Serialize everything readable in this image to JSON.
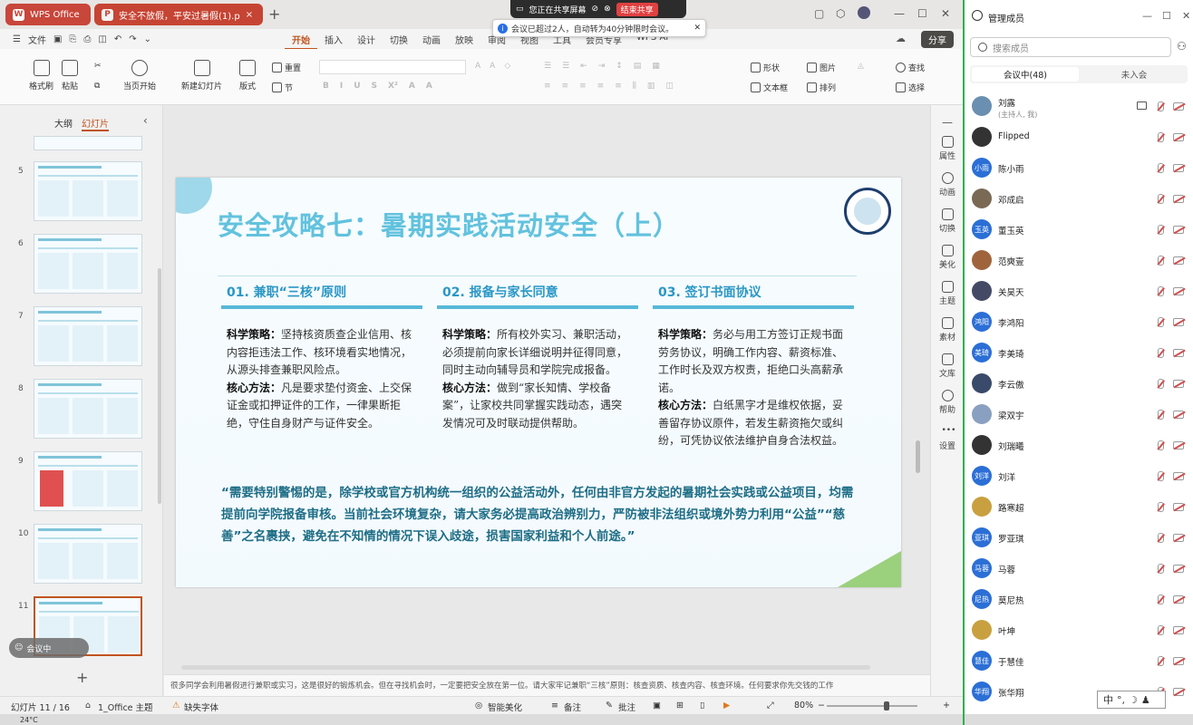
{
  "titlebar": {
    "tabs": [
      {
        "label": "WPS Office",
        "logo": "W"
      },
      {
        "label": "安全不放假，平安过暑假(1).p",
        "logo": "P"
      }
    ]
  },
  "share": {
    "status": "您正在共享屏幕",
    "stop": "结束共享",
    "notice": "会议已超过2人，自动转为40分钟限时会议。"
  },
  "menu": {
    "file": "文件",
    "tabs": [
      "开始",
      "插入",
      "设计",
      "切换",
      "动画",
      "放映",
      "审阅",
      "视图",
      "工具",
      "会员专享",
      "WPS AI"
    ],
    "share": "分享"
  },
  "ribbon": {
    "format_painter": "格式刷",
    "paste": "粘贴",
    "from_current": "当页开始",
    "new_slide": "新建幻灯片",
    "layout": "版式",
    "reset": "重置",
    "section": "节",
    "shape": "形状",
    "picture": "图片",
    "find": "查找",
    "textbox": "文本框",
    "arrange": "排列",
    "select": "选择"
  },
  "left_panel": {
    "tab_outline": "大纲",
    "tab_slides": "幻灯片",
    "slide_numbers": [
      "5",
      "6",
      "7",
      "8",
      "9",
      "10",
      "11"
    ],
    "meeting_pill": "会议中"
  },
  "slide": {
    "title": "安全攻略七：暑期实践活动安全（上）",
    "columns": [
      {
        "heading": "01. 兼职“三核”原则",
        "strategy_label": "科学策略：",
        "strategy": "坚持核资质查企业信用、核内容拒违法工作、核环境看实地情况，从源头排查兼职风险点。",
        "method_label": "核心方法：",
        "method": "凡是要求垫付资金、上交保证金或扣押证件的工作，一律果断拒绝，守住自身财产与证件安全。"
      },
      {
        "heading": "02. 报备与家长同意",
        "strategy_label": "科学策略：",
        "strategy": "所有校外实习、兼职活动，必须提前向家长详细说明并征得同意，同时主动向辅导员和学院完成报备。",
        "method_label": "核心方法：",
        "method": "做到“家长知情、学校备案”，让家校共同掌握实践动态，遇突发情况可及时联动提供帮助。"
      },
      {
        "heading": "03. 签订书面协议",
        "strategy_label": "科学策略：",
        "strategy": "务必与用工方签订正规书面劳务协议，明确工作内容、薪资标准、工作时长及双方权责，拒绝口头高薪承诺。",
        "method_label": "核心方法：",
        "method": "白纸黑字才是维权依据，妥善留存协议原件，若发生薪资拖欠或纠纷，可凭协议依法维护自身合法权益。"
      }
    ],
    "quote": "“需要特别警惕的是，除学校或官方机构统一组织的公益活动外，任何由非官方发起的暑期社会实践或公益项目，均需提前向学院报备审核。当前社会环境复杂，请大家务必提高政治辨别力，严防被非法组织或境外势力利用“公益”“慈善”之名裹挟，避免在不知情的情况下误入歧途，损害国家利益和个人前途。”"
  },
  "notes": "很多同学会利用暑假进行兼职或实习，这是很好的锻炼机会。但在寻找机会时，一定要把安全放在第一位。请大家牢记兼职“三核”原则：核查资质、核查内容、核查环境。任何要求你先交钱的工作",
  "right_tools": [
    "属性",
    "动画",
    "切换",
    "美化",
    "主题",
    "素材",
    "文库",
    "帮助",
    "设置"
  ],
  "status": {
    "slide_count": "幻灯片 11 / 16",
    "theme": "1_Office 主题",
    "missing_font": "缺失字体",
    "smart": "智能美化",
    "notes": "备注",
    "comments": "批注",
    "zoom": "80%"
  },
  "taskbar": {
    "weather": "24°C"
  },
  "members": {
    "title": "管理成员",
    "search_placeholder": "搜索成员",
    "tab_in": "会议中(48)",
    "tab_out": "未入会",
    "list": [
      {
        "name": "刘露",
        "sub": "(主持人, 我)",
        "avatar": "",
        "color": "#6a8fb0"
      },
      {
        "name": "Flipped",
        "sub": "",
        "avatar": "",
        "color": "#333333"
      },
      {
        "name": "陈小雨",
        "sub": "",
        "avatar": "小雨",
        "color": "#2b6fd6"
      },
      {
        "name": "邓成启",
        "sub": "",
        "avatar": "",
        "color": "#7a6a55"
      },
      {
        "name": "董玉英",
        "sub": "",
        "avatar": "玉英",
        "color": "#2b6fd6"
      },
      {
        "name": "范奭壹",
        "sub": "",
        "avatar": "",
        "color": "#a0643c"
      },
      {
        "name": "关昊天",
        "sub": "",
        "avatar": "",
        "color": "#444a66"
      },
      {
        "name": "李鸿阳",
        "sub": "",
        "avatar": "鸿阳",
        "color": "#2b6fd6"
      },
      {
        "name": "李美琦",
        "sub": "",
        "avatar": "美琦",
        "color": "#2b6fd6"
      },
      {
        "name": "李云傲",
        "sub": "",
        "avatar": "",
        "color": "#3a4a6a"
      },
      {
        "name": "梁双宇",
        "sub": "",
        "avatar": "",
        "color": "#8aa0c0"
      },
      {
        "name": "刘瑞曦",
        "sub": "",
        "avatar": "",
        "color": "#333333"
      },
      {
        "name": "刘洋",
        "sub": "",
        "avatar": "刘洋",
        "color": "#2b6fd6"
      },
      {
        "name": "路寒超",
        "sub": "",
        "avatar": "",
        "color": "#c8a040"
      },
      {
        "name": "罗亚琪",
        "sub": "",
        "avatar": "亚琪",
        "color": "#2b6fd6"
      },
      {
        "name": "马蓉",
        "sub": "",
        "avatar": "马蓉",
        "color": "#2b6fd6"
      },
      {
        "name": "莫尼热",
        "sub": "",
        "avatar": "尼热",
        "color": "#2b6fd6"
      },
      {
        "name": "叶坤",
        "sub": "",
        "avatar": "",
        "color": "#c8a040"
      },
      {
        "name": "于慧佳",
        "sub": "",
        "avatar": "慧佳",
        "color": "#2b6fd6"
      },
      {
        "name": "张华翔",
        "sub": "",
        "avatar": "华翔",
        "color": "#2b6fd6"
      }
    ]
  },
  "ime": "中"
}
